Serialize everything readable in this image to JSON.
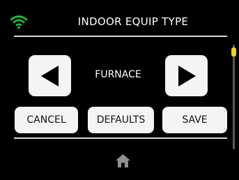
{
  "header": {
    "title": "INDOOR EQUIP TYPE",
    "wifi_icon": "wifi-icon",
    "wifi_color": "#19c437"
  },
  "selector": {
    "value": "FURNACE",
    "prev_icon": "triangle-left-icon",
    "next_icon": "triangle-right-icon"
  },
  "actions": {
    "cancel_label": "CANCEL",
    "defaults_label": "DEFAULTS",
    "save_label": "SAVE"
  },
  "footer": {
    "home_icon": "home-icon"
  },
  "scroll": {
    "thumb_color": "#f4d018"
  }
}
